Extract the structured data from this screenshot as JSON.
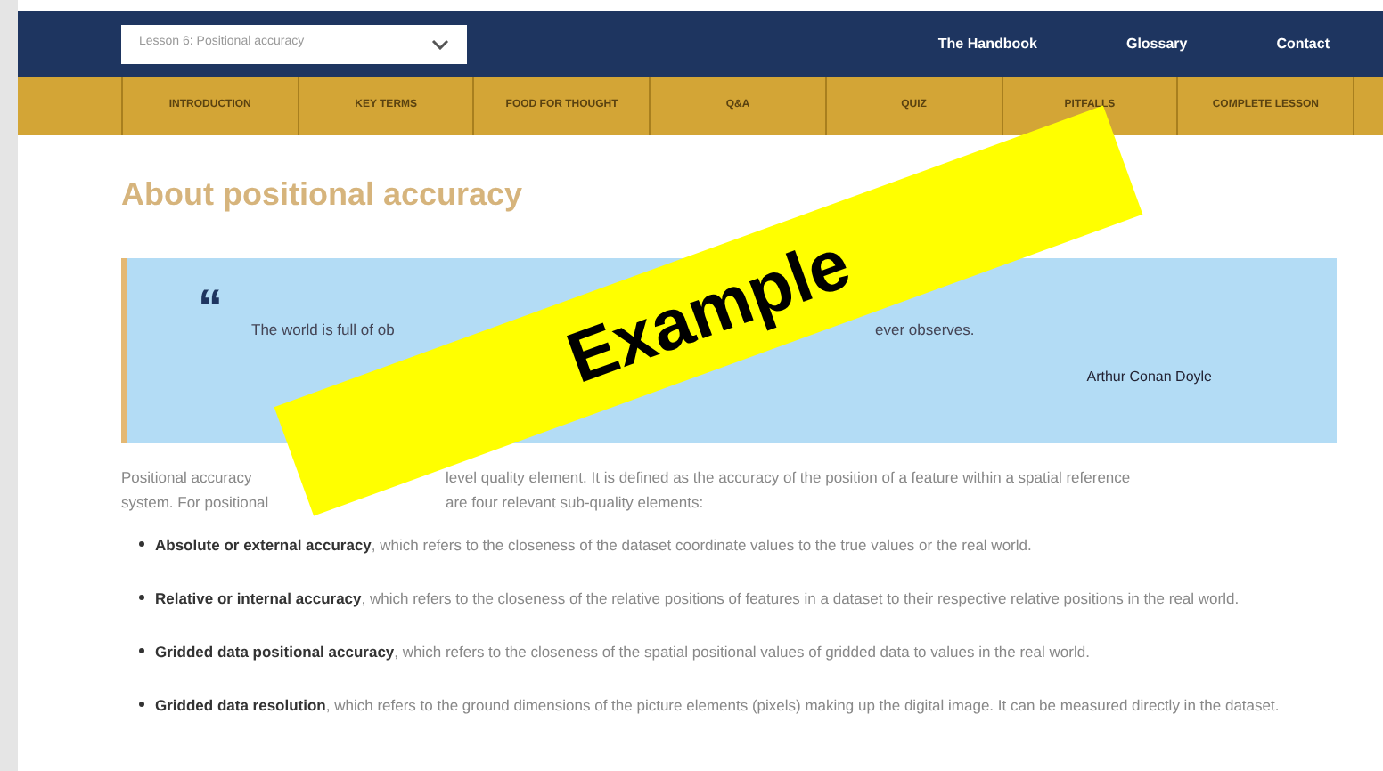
{
  "header": {
    "lesson_select": {
      "value": "Lesson 6: Positional accuracy"
    },
    "links": [
      "The Handbook",
      "Glossary",
      "Contact"
    ]
  },
  "tabs": [
    {
      "label": "INTRODUCTION",
      "selected": false
    },
    {
      "label": "KEY TERMS",
      "selected": false
    },
    {
      "label": "FOOD FOR THOUGHT",
      "selected": false
    },
    {
      "label": "Q&A",
      "selected": false
    },
    {
      "label": "QUIZ",
      "selected": false
    },
    {
      "label": "PITFALLS",
      "selected": false
    },
    {
      "label": "COMPLETE LESSON",
      "selected": false
    }
  ],
  "heading": "About positional accuracy",
  "quote": {
    "mark": "“",
    "fragments": [
      "The world is full of ob",
      "ever observes."
    ],
    "author": "Arthur Conan Doyle"
  },
  "intro": [
    [
      "Positional accuracy",
      "level quality element. It is defined as the accuracy of the position of a feature within a spatial reference"
    ],
    [
      "system. For positional",
      "are four relevant sub-quality elements:"
    ]
  ],
  "bullets": [
    "**Absolute or external accuracy**, which refers to the closeness of the dataset coordinate values to the true values or the real world.",
    "**Relative or internal accuracy**, which refers to the closeness of the relative positions of features in a dataset to their respective relative positions in the real world.",
    "**Gridded data positional accuracy**, which refers to the closeness of the spatial positional values of gridded data to values in the real world.",
    "**Gridded data resolution**, which refers to the ground dimensions of the picture elements (pixels) making up the digital image. It can be measured directly in the dataset."
  ],
  "banner": {
    "text": "Example"
  }
}
